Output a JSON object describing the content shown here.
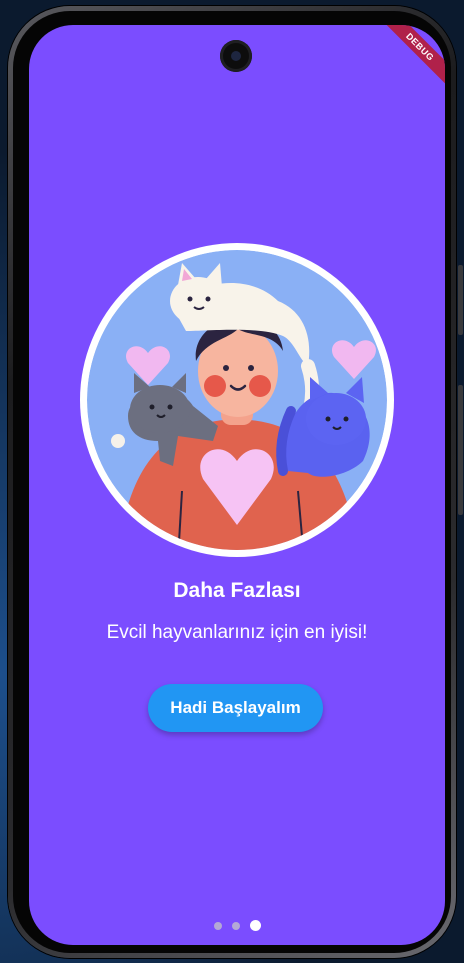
{
  "badge": {
    "debug": "DEBUG"
  },
  "onboarding": {
    "title": "Daha Fazlası",
    "subtitle": "Evcil hayvanlarınız için en iyisi!",
    "cta_label": "Hadi Başlayalım",
    "illustration": "boy-with-three-cats",
    "page_count": 3,
    "active_page": 3
  },
  "colors": {
    "background": "#7b4dff",
    "button": "#2196f3",
    "illustration_circle": "#8ab0f5",
    "sweater": "#e0634e",
    "heart": "#f6c3f4"
  }
}
